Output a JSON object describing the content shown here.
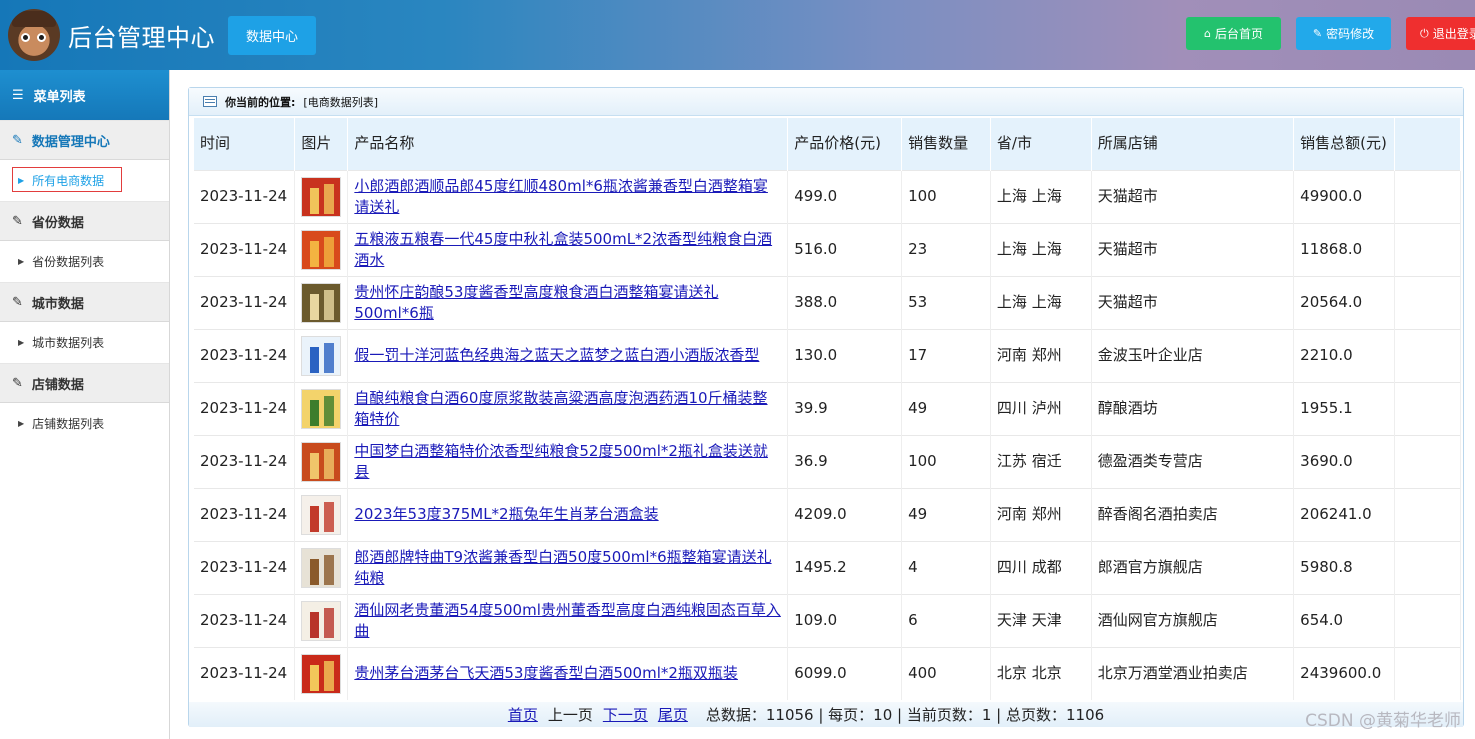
{
  "header": {
    "title": "后台管理中心",
    "tab": "数据中心",
    "home_btn": "后台首页",
    "pwd_btn": "密码修改",
    "logout_btn": "退出登录",
    "icons": [
      "home-icon",
      "wrench-icon",
      "power-icon"
    ],
    "colors": {
      "home": "#23c26e",
      "pwd": "#22a9ea",
      "logout": "#ef2f2f"
    }
  },
  "sidebar": {
    "title": "菜单列表",
    "groups": [
      {
        "label": "数据管理中心",
        "item": "所有电商数据",
        "active": true
      },
      {
        "label": "省份数据",
        "item": "省份数据列表"
      },
      {
        "label": "城市数据",
        "item": "城市数据列表"
      },
      {
        "label": "店铺数据",
        "item": "店铺数据列表"
      }
    ]
  },
  "breadcrumb": {
    "label": "你当前的位置:",
    "value": "[电商数据列表]"
  },
  "table": {
    "columns": [
      "时间",
      "图片",
      "产品名称",
      "产品价格(元)",
      "销售数量",
      "省/市",
      "所属店铺",
      "销售总额(元)"
    ],
    "rows": [
      {
        "time": "2023-11-24",
        "name": "小郎酒郎酒顺品郎45度红顺480ml*6瓶浓酱兼香型白酒整箱宴请送礼",
        "price": "499.0",
        "qty": "100",
        "region": "上海 上海",
        "shop": "天猫超市",
        "total": "49900.0"
      },
      {
        "time": "2023-11-24",
        "name": "五粮液五粮春一代45度中秋礼盒装500mL*2浓香型纯粮食白酒酒水",
        "price": "516.0",
        "qty": "23",
        "region": "上海 上海",
        "shop": "天猫超市",
        "total": "11868.0"
      },
      {
        "time": "2023-11-24",
        "name": "贵州怀庄韵酿53度酱香型高度粮食酒白酒整箱宴请送礼500ml*6瓶",
        "price": "388.0",
        "qty": "53",
        "region": "上海 上海",
        "shop": "天猫超市",
        "total": "20564.0"
      },
      {
        "time": "2023-11-24",
        "name": "假一罚十洋河蓝色经典海之蓝天之蓝梦之蓝白酒小酒版浓香型",
        "price": "130.0",
        "qty": "17",
        "region": "河南 郑州",
        "shop": "金波玉叶企业店",
        "total": "2210.0"
      },
      {
        "time": "2023-11-24",
        "name": "自酿纯粮食白酒60度原浆散装高粱酒高度泡酒药酒10斤桶装整箱特价",
        "price": "39.9",
        "qty": "49",
        "region": "四川 泸州",
        "shop": "醇酿酒坊",
        "total": "1955.1"
      },
      {
        "time": "2023-11-24",
        "name": "中国梦白酒整箱特价浓香型纯粮食52度500ml*2瓶礼盒装送就县",
        "price": "36.9",
        "qty": "100",
        "region": "江苏 宿迁",
        "shop": "德盈酒类专营店",
        "total": "3690.0"
      },
      {
        "time": "2023-11-24",
        "name": "2023年53度375ML*2瓶兔年生肖茅台酒盒装",
        "price": "4209.0",
        "qty": "49",
        "region": "河南 郑州",
        "shop": "醉香阁名酒拍卖店",
        "total": "206241.0"
      },
      {
        "time": "2023-11-24",
        "name": "郎酒郎牌特曲T9浓酱兼香型白酒50度500ml*6瓶整箱宴请送礼纯粮",
        "price": "1495.2",
        "qty": "4",
        "region": "四川 成都",
        "shop": "郎酒官方旗舰店",
        "total": "5980.8"
      },
      {
        "time": "2023-11-24",
        "name": "酒仙网老贵董酒54度500ml贵州董香型高度白酒纯粮固态百草入曲",
        "price": "109.0",
        "qty": "6",
        "region": "天津 天津",
        "shop": "酒仙网官方旗舰店",
        "total": "654.0"
      },
      {
        "time": "2023-11-24",
        "name": "贵州茅台酒茅台飞天酒53度酱香型白酒500ml*2瓶双瓶装",
        "price": "6099.0",
        "qty": "400",
        "region": "北京 北京",
        "shop": "北京万酒堂酒业拍卖店",
        "total": "2439600.0"
      }
    ]
  },
  "pager": {
    "first": "首页",
    "prev": "上一页",
    "next": "下一页",
    "last": "尾页",
    "summary": "总数据：11056 | 每页：10 | 当前页数：1 | 总页数：1106"
  },
  "watermark": "CSDN @黄菊华老师"
}
